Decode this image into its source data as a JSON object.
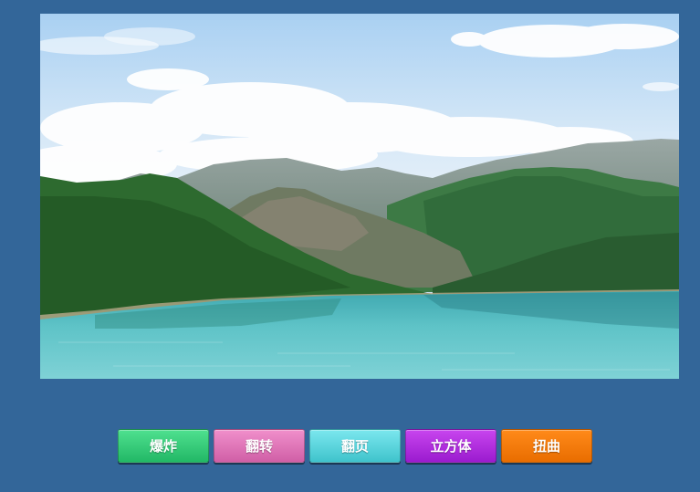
{
  "image": {
    "alt": ""
  },
  "buttons": [
    {
      "label": "爆炸",
      "color": "#2fcc75"
    },
    {
      "label": "翻转",
      "color": "#e37abd"
    },
    {
      "label": "翻页",
      "color": "#5fd6de"
    },
    {
      "label": "立方体",
      "color": "#b22fe0"
    },
    {
      "label": "扭曲",
      "color": "#f27a05"
    }
  ]
}
